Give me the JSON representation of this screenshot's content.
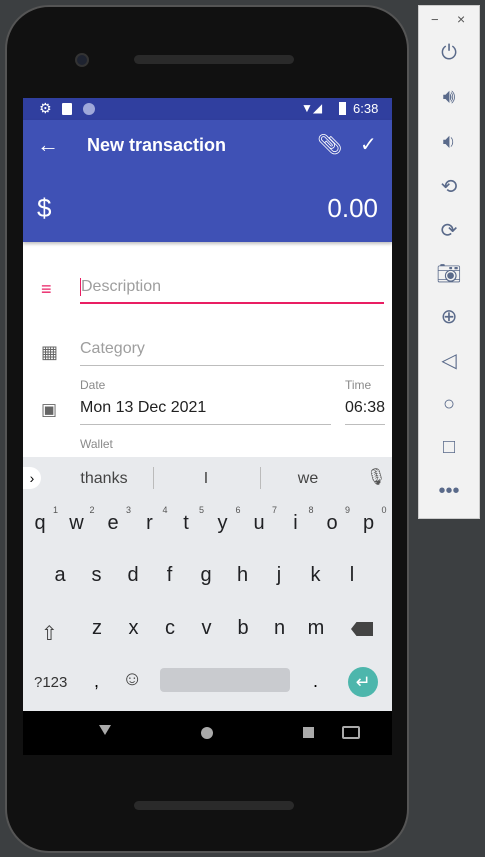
{
  "status": {
    "time": "6:38"
  },
  "appbar": {
    "title": "New transaction",
    "currency": "$",
    "amount": "0.00"
  },
  "form": {
    "description_placeholder": "Description",
    "category_placeholder": "Category",
    "date_label": "Date",
    "date_value": "Mon 13 Dec 2021",
    "time_label": "Time",
    "time_value": "06:38",
    "wallet_label": "Wallet"
  },
  "keyboard": {
    "suggestions": [
      "thanks",
      "I",
      "we"
    ],
    "row1": [
      "q",
      "w",
      "e",
      "r",
      "t",
      "y",
      "u",
      "i",
      "o",
      "p"
    ],
    "row1_hints": [
      "1",
      "2",
      "3",
      "4",
      "5",
      "6",
      "7",
      "8",
      "9",
      "0"
    ],
    "row2": [
      "a",
      "s",
      "d",
      "f",
      "g",
      "h",
      "j",
      "k",
      "l"
    ],
    "row3": [
      "z",
      "x",
      "c",
      "v",
      "b",
      "n",
      "m"
    ],
    "symbols_label": "?123",
    "comma": ",",
    "period": "."
  },
  "colors": {
    "primary": "#3f51b5",
    "status": "#303f9f",
    "accent": "#e91e63",
    "enter": "#4db6ac"
  },
  "side_panel": {
    "minimize": "−",
    "close": "×"
  }
}
